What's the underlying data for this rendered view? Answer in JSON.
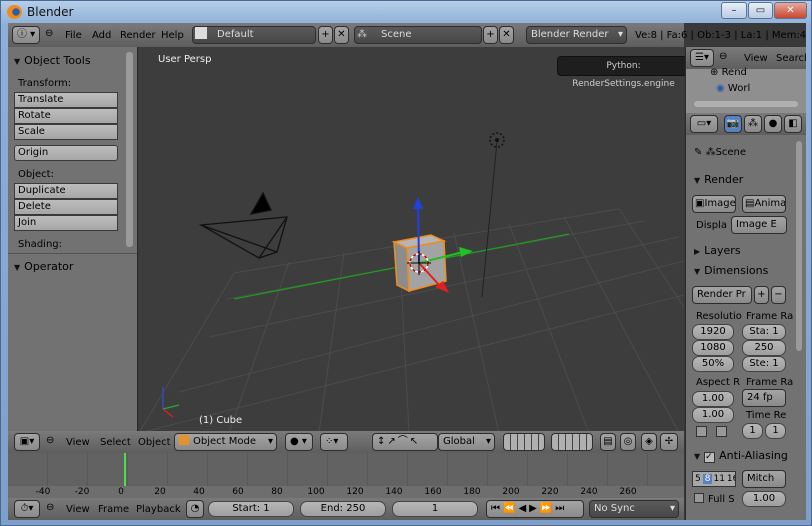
{
  "window": {
    "title": "Blender",
    "min": "–",
    "max": "▭",
    "close": "✕"
  },
  "info": {
    "menus": [
      "File",
      "Add",
      "Render",
      "Help"
    ],
    "screen": "Default",
    "scene": "Scene",
    "engine": "Blender Render",
    "stats": "Ve:8 | Fa:6 | Ob:1-3 | La:1 | Mem:4.21M (0..."
  },
  "tooltip": "Python: RenderSettings.engine",
  "toolshelf": {
    "title": "Object Tools",
    "transform_label": "Transform:",
    "translate": "Translate",
    "rotate": "Rotate",
    "scale": "Scale",
    "origin": "Origin",
    "object_label": "Object:",
    "duplicate": "Duplicate",
    "delete": "Delete",
    "join": "Join",
    "shading_label": "Shading:",
    "operator": "Operator"
  },
  "viewport": {
    "view_name": "User Persp",
    "object_name": "(1) Cube"
  },
  "view3d_header": {
    "view": "View",
    "select": "Select",
    "object": "Object",
    "mode": "Object Mode",
    "orientation": "Global"
  },
  "timeline": {
    "ticks": [
      "-40",
      "-20",
      "0",
      "20",
      "40",
      "60",
      "80",
      "100",
      "120",
      "140",
      "160",
      "180",
      "200",
      "220",
      "240",
      "260"
    ],
    "current_frame_value": 0
  },
  "timeline_header": {
    "view": "View",
    "frame": "Frame",
    "playback": "Playback",
    "start": "Start: 1",
    "end": "End: 250",
    "current": "1",
    "sync": "No Sync"
  },
  "outliner": {
    "view": "View",
    "search": "Search",
    "items": [
      "Rend",
      "Worl"
    ]
  },
  "properties": {
    "scene": "Scene",
    "render": "Render",
    "image": "Image",
    "animation": "Animatio",
    "display_label": "Displa",
    "display_value": "Image E",
    "layers": "Layers",
    "dimensions": "Dimensions",
    "preset": "Render Pr",
    "resolution": "Resolutio",
    "res_x": "1920",
    "res_y": "1080",
    "res_pct": "50%",
    "frame_range": "Frame Ra",
    "sta": "Sta: 1",
    "end": "250",
    "ste": "Ste: 1",
    "aspect": "Aspect R",
    "asp_x": "1.00",
    "asp_y": "1.00",
    "frame_rate": "Frame Ra",
    "fps": "24 fp",
    "time_re": "Time Re",
    "t1": "1",
    "t2": "1",
    "aa": "Anti-Aliasing",
    "aa_samples": [
      "5",
      "8",
      "11",
      "16"
    ],
    "aa_filter": "Mitch",
    "full_sample": "Full S",
    "filter_size": "1.00"
  },
  "colors": {
    "viewport_bg": "#3d3d3d",
    "grid": "#4a4a4a",
    "x_axis": "#1e9e1e",
    "selection": "#f08c1e"
  }
}
